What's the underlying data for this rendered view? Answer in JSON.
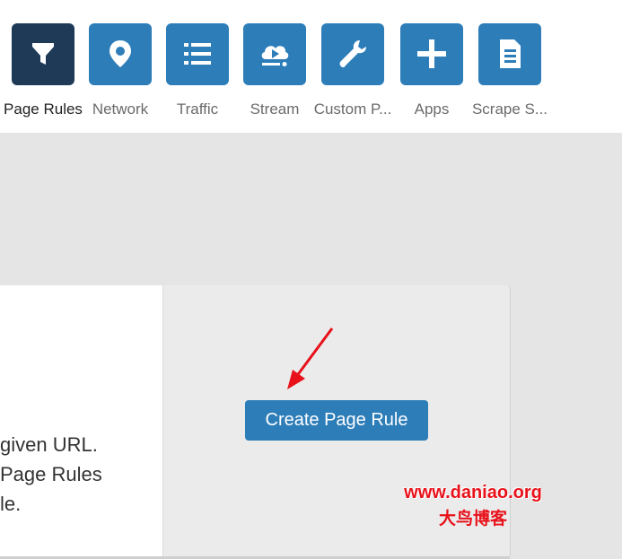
{
  "nav": {
    "items": [
      {
        "label": "Page Rules",
        "icon": "filter-icon",
        "active": true
      },
      {
        "label": "Network",
        "icon": "location-pin-icon",
        "active": false
      },
      {
        "label": "Traffic",
        "icon": "list-icon",
        "active": false
      },
      {
        "label": "Stream",
        "icon": "cloud-stream-icon",
        "active": false
      },
      {
        "label": "Custom P...",
        "icon": "wrench-icon",
        "active": false
      },
      {
        "label": "Apps",
        "icon": "plus-icon",
        "active": false
      },
      {
        "label": "Scrape S...",
        "icon": "document-icon",
        "active": false
      }
    ]
  },
  "panel": {
    "description_lines": [
      "given URL.",
      "Page Rules",
      "le."
    ],
    "create_button_label": "Create Page Rule"
  },
  "watermark": {
    "url": "www.daniao.org",
    "name": "大鸟博客"
  },
  "colors": {
    "accent": "#2d7db8",
    "active_tile": "#1e3a57",
    "watermark": "#e8111a"
  }
}
